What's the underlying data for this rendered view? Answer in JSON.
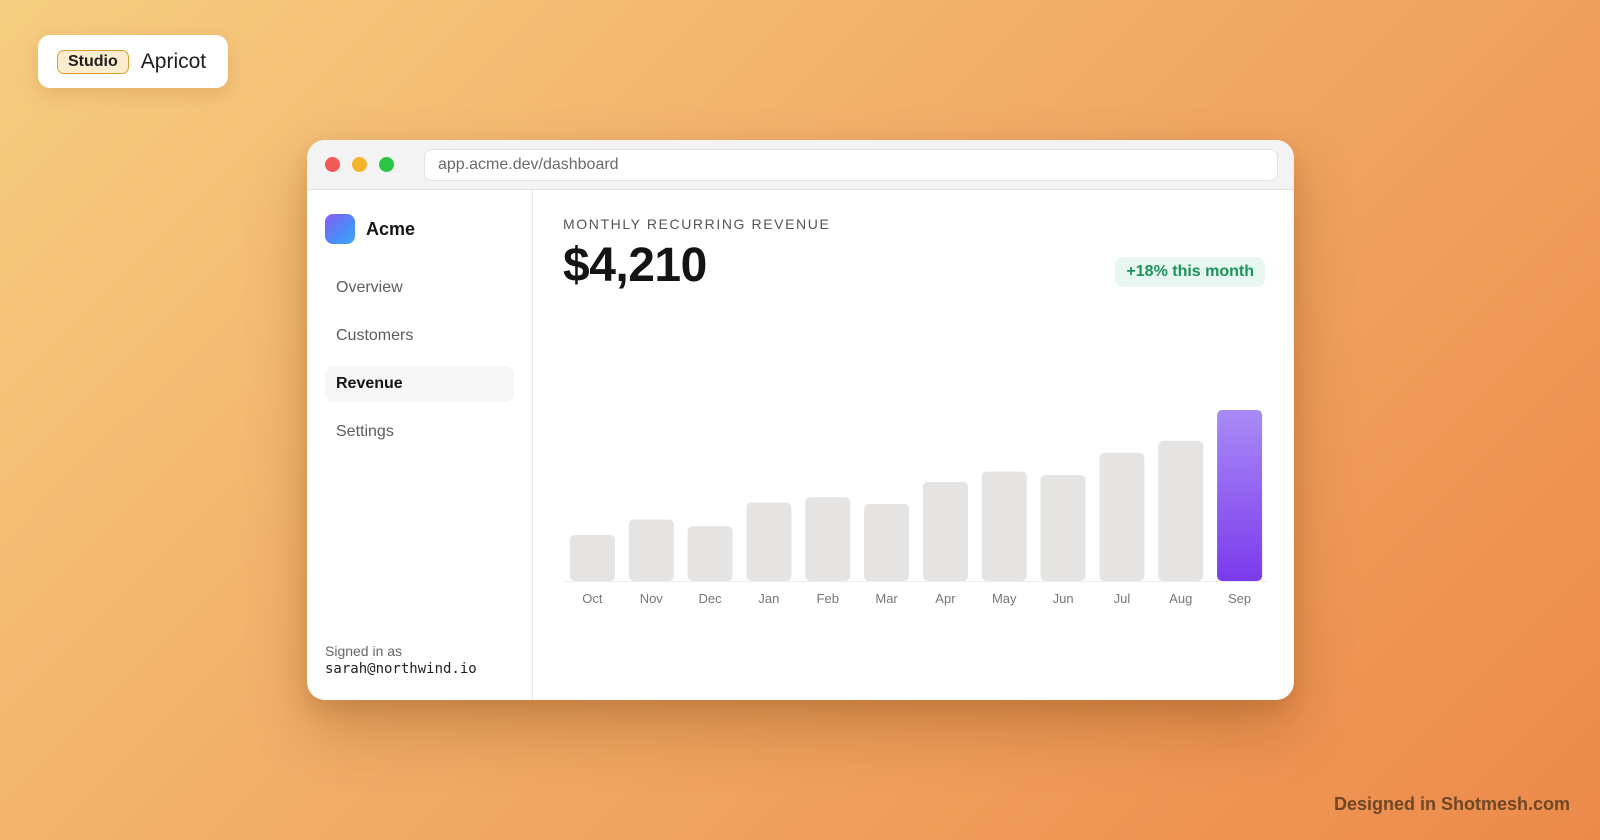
{
  "brand": {
    "tag": "Studio",
    "name": "Apricot"
  },
  "browser": {
    "url": "app.acme.dev/dashboard"
  },
  "sidebar": {
    "app_name": "Acme",
    "items": [
      {
        "label": "Overview",
        "active": false
      },
      {
        "label": "Customers",
        "active": false
      },
      {
        "label": "Revenue",
        "active": true
      },
      {
        "label": "Settings",
        "active": false
      }
    ],
    "signed_in_label": "Signed in as",
    "signed_in_email": "sarah@northwind.io"
  },
  "main": {
    "kicker": "MONTHLY RECURRING REVENUE",
    "value": "$4,210",
    "delta": "+18% this month"
  },
  "chart_data": {
    "type": "bar",
    "categories": [
      "Oct",
      "Nov",
      "Dec",
      "Jan",
      "Feb",
      "Mar",
      "Apr",
      "May",
      "Jun",
      "Jul",
      "Aug",
      "Sep"
    ],
    "values": [
      27,
      36,
      32,
      46,
      49,
      45,
      58,
      64,
      62,
      75,
      82,
      100
    ],
    "highlight_index": 11,
    "colors": {
      "bar": "#e5e4e2",
      "highlight_top": "#a98bf6",
      "highlight_bottom": "#7b3aec"
    }
  },
  "footer": {
    "credit": "Designed in Shotmesh.com"
  },
  "colors": {
    "accent": "#7b3aec",
    "positive": "#19935b"
  }
}
